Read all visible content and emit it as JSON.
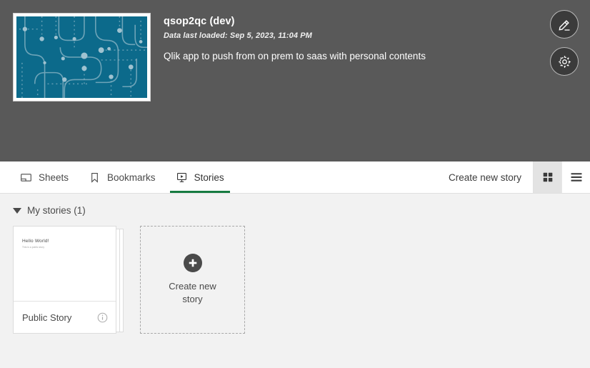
{
  "header": {
    "app_title": "qsop2qc (dev)",
    "data_last_loaded": "Data last loaded: Sep 5, 2023, 11:04 PM",
    "app_description": "Qlik app to push from on prem to saas with personal contents",
    "thumbnail_bg_color": "#0c6a8b",
    "background_color": "#595959",
    "edit_button_icon": "pencil-icon",
    "settings_button_icon": "gear-icon"
  },
  "tabs": [
    {
      "label": "Sheets",
      "icon": "sheets-icon",
      "active": false
    },
    {
      "label": "Bookmarks",
      "icon": "bookmark-icon",
      "active": false
    },
    {
      "label": "Stories",
      "icon": "stories-icon",
      "active": true
    }
  ],
  "toolbar": {
    "create_new_story_label": "Create new story",
    "grid_view_icon": "grid-view-icon",
    "list_view_icon": "list-view-icon",
    "selected_view": "grid",
    "active_tab_underline_color": "#177b41"
  },
  "section": {
    "title": "My stories (1)",
    "expanded": true
  },
  "stories": [
    {
      "name": "Public Story",
      "thumbnail_title": "Hello World!",
      "thumbnail_subtitle": "This is a public story",
      "info_icon": "info-icon"
    }
  ],
  "create_tile": {
    "label": "Create new story",
    "icon": "plus-icon"
  }
}
